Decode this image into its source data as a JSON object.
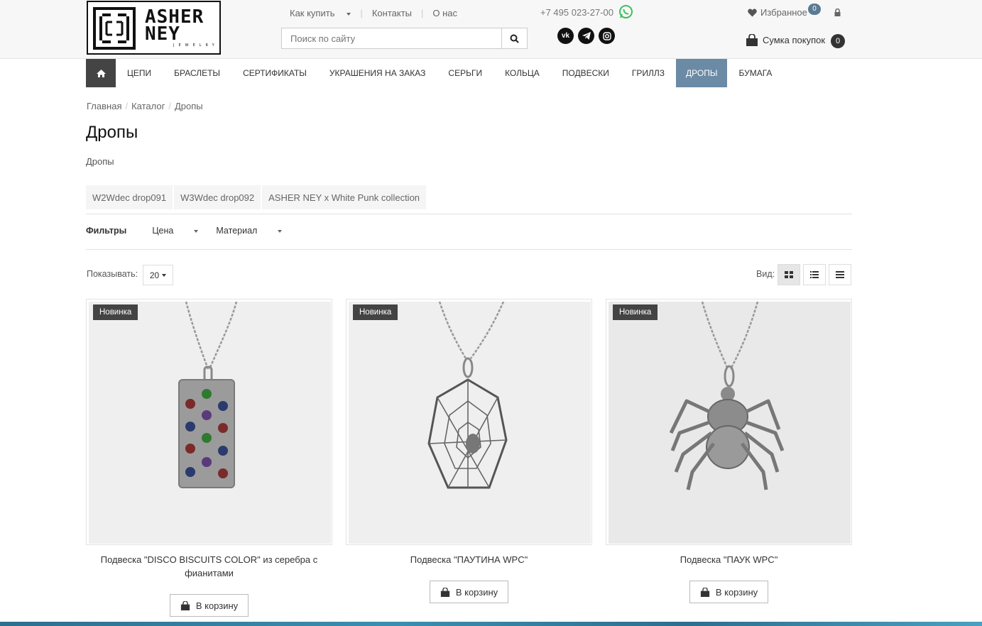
{
  "brand": {
    "line1": "ASHER",
    "line2": "NEY",
    "sub": "JEWELRY"
  },
  "topnav": {
    "how_to_buy": "Как купить",
    "contacts": "Контакты",
    "about": "О нас"
  },
  "search": {
    "placeholder": "Поиск по сайту"
  },
  "phone": "+7 495 023-27-00",
  "socials": {
    "vk": "vk",
    "telegram": "tg",
    "instagram": "ig"
  },
  "favorites": {
    "label": "Избранное",
    "count": "0"
  },
  "cart": {
    "label": "Сумка покупок",
    "count": "0"
  },
  "menu": [
    {
      "label": "ЦЕПИ"
    },
    {
      "label": "БРАСЛЕТЫ"
    },
    {
      "label": "СЕРТИФИКАТЫ"
    },
    {
      "label": "УКРАШЕНИЯ НА ЗАКАЗ"
    },
    {
      "label": "СЕРЬГИ"
    },
    {
      "label": "КОЛЬЦА"
    },
    {
      "label": "ПОДВЕСКИ"
    },
    {
      "label": "ГРИЛЛЗ"
    },
    {
      "label": "ДРОПЫ",
      "active": true
    },
    {
      "label": "БУМАГА"
    }
  ],
  "breadcrumb": {
    "home": "Главная",
    "catalog": "Каталог",
    "current": "Дропы"
  },
  "page": {
    "title": "Дропы",
    "subtitle": "Дропы"
  },
  "tags": [
    "W2Wdec drop091",
    "W3Wdec drop092",
    "ASHER NEY x White Punk collection"
  ],
  "filters": {
    "label": "Фильтры",
    "price": "Цена",
    "material": "Материал"
  },
  "show": {
    "label": "Показывать:",
    "value": "20"
  },
  "view": {
    "label": "Вид:"
  },
  "products": [
    {
      "badge": "Новинка",
      "name": "Подвеска \"DISCO BISCUITS COLOR\" из серебра с фианитами",
      "buy": "В корзину"
    },
    {
      "badge": "Новинка",
      "name": "Подвеска \"ПАУТИНА WPC\"",
      "buy": "В корзину"
    },
    {
      "badge": "Новинка",
      "name": "Подвеска \"ПАУК WPC\"",
      "buy": "В корзину"
    }
  ],
  "colors": {
    "accent": "#6b8aa5",
    "dark": "#444444",
    "badge": "#5b7a93"
  }
}
